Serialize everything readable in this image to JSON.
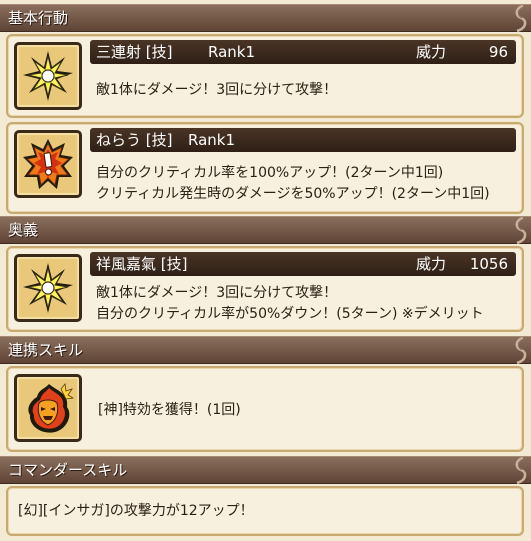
{
  "sections": {
    "basic": "基本行動",
    "ougi": "奥義",
    "renkei": "連携スキル",
    "commander": "コマンダースキル"
  },
  "skills": {
    "sanrensha": {
      "name": "三連射 [技]",
      "rank": "Rank1",
      "power_label": "威力",
      "power_value": "96",
      "desc1": "敵1体にダメージ！3回に分けて攻撃！"
    },
    "nerau": {
      "name": "ねらう [技]",
      "rank": "Rank1",
      "desc1": "自分のクリティカル率を100%アップ！(2ターン中1回)",
      "desc2": "クリティカル発生時のダメージを50%アップ！(2ターン中1回)"
    },
    "shofu": {
      "name": "祥風嘉氣 [技]",
      "power_label": "威力",
      "power_value": "1056",
      "desc1": "敵1体にダメージ！3回に分けて攻撃！",
      "desc2": "自分のクリティカル率が50%ダウン！(5ターン) ※デメリット"
    },
    "renkei": {
      "desc1": "[神]特効を獲得！(1回)"
    },
    "commander": {
      "desc1": "[幻][インサガ]の攻撃力が12アップ！"
    }
  },
  "icons": {
    "burst": "burst-star-icon",
    "critical": "critical-alert-icon",
    "flame_mask": "flame-mask-icon",
    "curl": "scroll-curl-icon"
  },
  "colors": {
    "header_bg": "#6b4f3f",
    "title_bg": "#3a2a1c",
    "card_bg": "#f7f0de",
    "card_border": "#c9a972",
    "icon_frame": "#e9c979"
  }
}
